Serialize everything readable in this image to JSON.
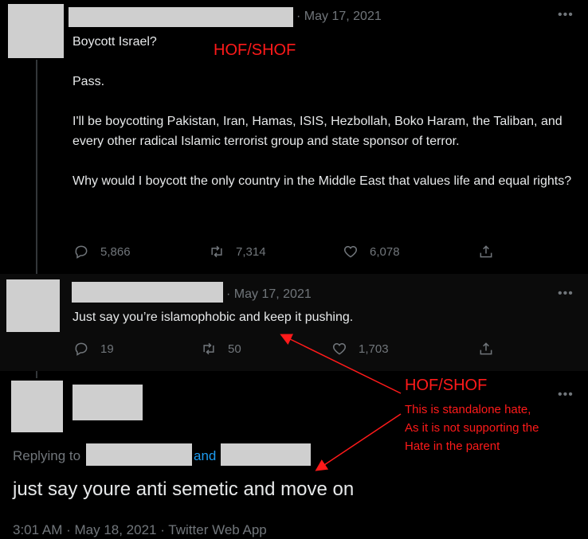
{
  "tweet1": {
    "date": "May 17, 2021",
    "text": "Boycott Israel?\n\nPass.\n\nI'll be boycotting Pakistan, Iran, Hamas, ISIS, Hezbollah, Boko Haram, the Taliban, and every other radical Islamic terrorist group and state sponsor of terror.\n\nWhy would I boycott the only country in the Middle East that values life and equal rights?",
    "replies": "5,866",
    "retweets": "7,314",
    "likes": "6,078"
  },
  "tweet2": {
    "date": "May 17, 2021",
    "text": "Just say you’re islamophobic and keep it pushing.",
    "replies": "19",
    "retweets": "50",
    "likes": "1,703"
  },
  "tweet3": {
    "replying_to": "Replying to",
    "and": "and",
    "text": "just say youre anti semetic and move on",
    "timestamp": "3:01 AM · May 18, 2021 · Twitter Web App"
  },
  "annotations": {
    "label_top": "HOF/SHOF",
    "label_bottom": "HOF/SHOF",
    "note": "This is standalone hate,\nAs it is not supporting the\nHate in  the parent"
  },
  "icons": {
    "reply": "reply-icon",
    "retweet": "retweet-icon",
    "like": "heart-icon",
    "share": "share-icon",
    "more": "more-icon"
  },
  "colors": {
    "background": "#000000",
    "text": "#e7e9ea",
    "muted": "#71767b",
    "annotation": "#ff1a1a",
    "link": "#1d9bf0"
  }
}
